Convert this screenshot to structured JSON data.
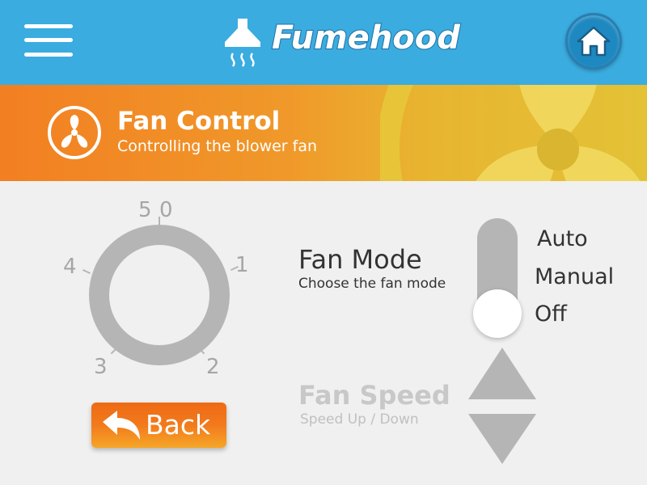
{
  "app": {
    "logo_text": "Fumehood"
  },
  "topbar": {
    "menu_icon": "hamburger-menu-icon",
    "home_icon": "home-icon"
  },
  "header": {
    "title": "Fan Control",
    "subtitle": "Controlling the blower fan",
    "icon": "fan-icon"
  },
  "dial": {
    "labels": {
      "l0": "0",
      "l1": "1",
      "l2": "2",
      "l3": "3",
      "l4": "4",
      "l5": "5"
    }
  },
  "back_button": {
    "label": "Back",
    "icon": "back-arrow-icon"
  },
  "fan_mode": {
    "title": "Fan Mode",
    "subtitle": "Choose the fan mode",
    "options": [
      "Auto",
      "Manual",
      "Off"
    ],
    "selected": "Off"
  },
  "fan_speed": {
    "title": "Fan Speed",
    "subtitle": "Speed Up / Down"
  },
  "colors": {
    "topbar": "#3aace0",
    "header_orange": "#f08a24",
    "header_yellow": "#e3c236",
    "inactive_gray": "#b5b5b5",
    "back_button": "#f27a1c"
  }
}
